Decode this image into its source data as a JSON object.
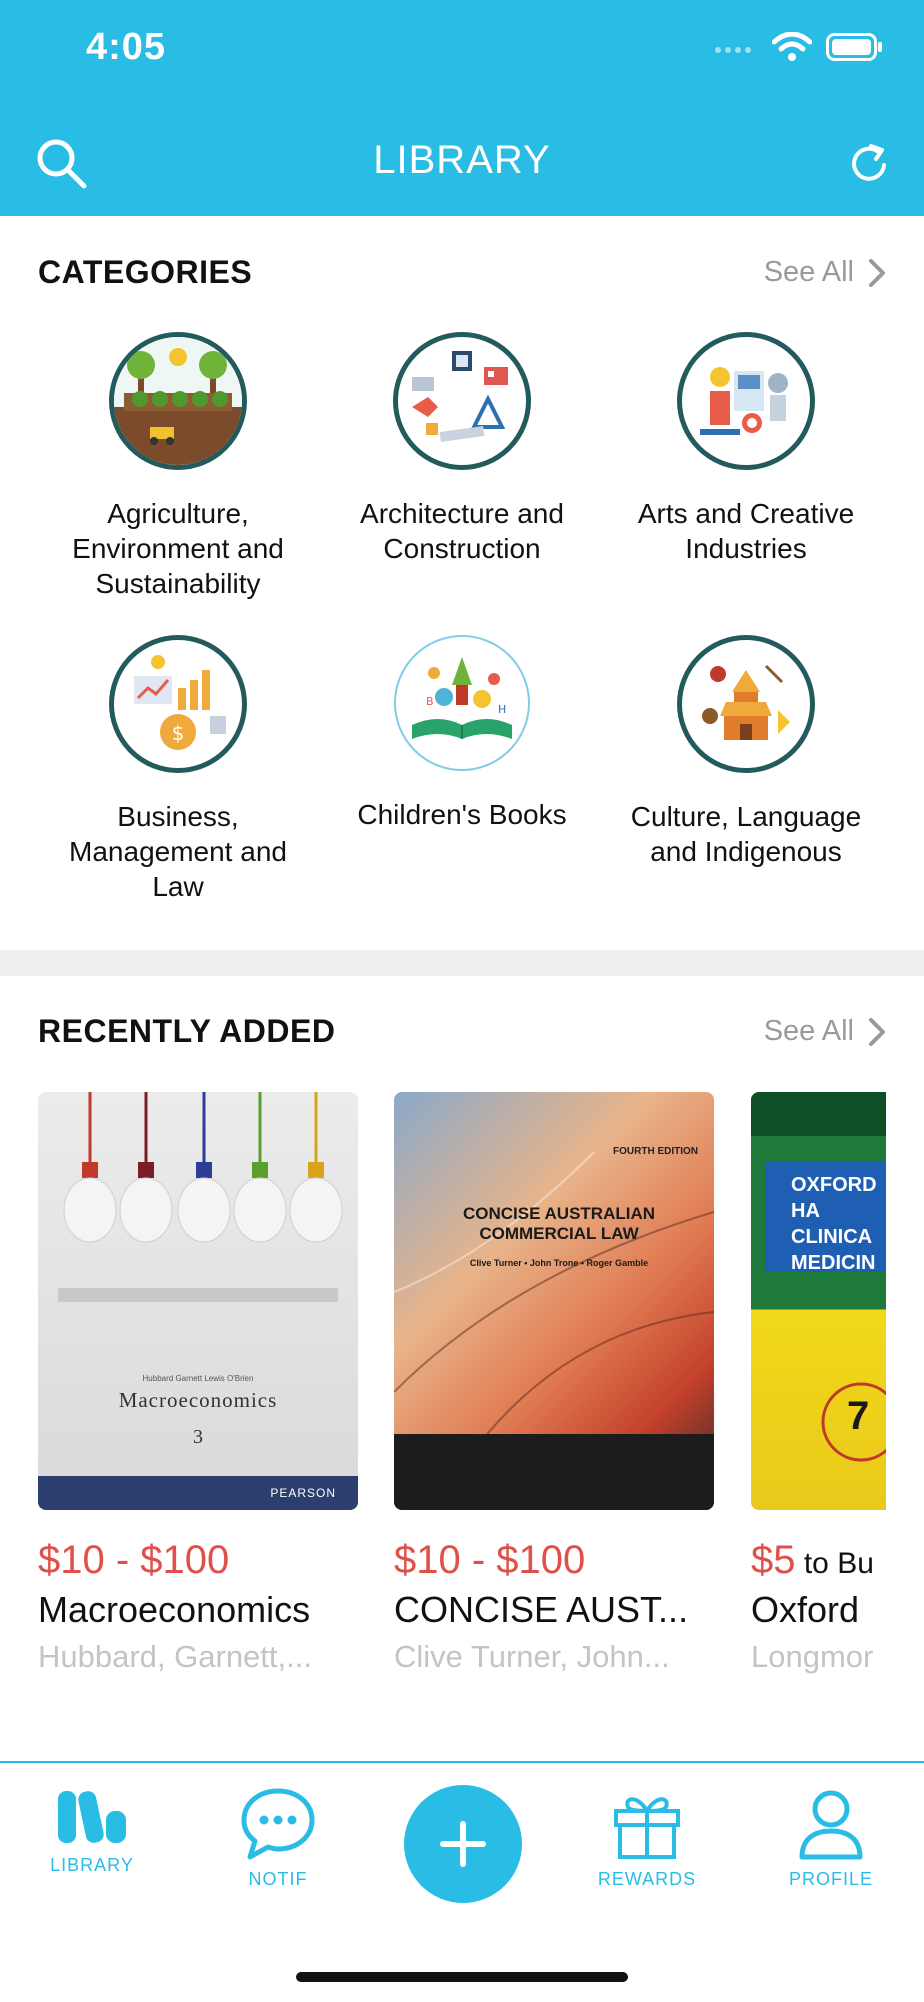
{
  "status": {
    "time": "4:05"
  },
  "header": {
    "title": "LIBRARY"
  },
  "categories": {
    "heading": "CATEGORIES",
    "see_all": "See All",
    "items": [
      {
        "label": "Agriculture, Environment and Sustainability",
        "icon": "agriculture-icon"
      },
      {
        "label": "Architecture and Construction",
        "icon": "architecture-icon"
      },
      {
        "label": "Arts and Creative Industries",
        "icon": "arts-icon"
      },
      {
        "label": "Business, Management and Law",
        "icon": "business-icon"
      },
      {
        "label": "Children's Books",
        "icon": "childrens-books-icon"
      },
      {
        "label": "Culture, Language and Indigenous",
        "icon": "culture-icon"
      }
    ]
  },
  "recent": {
    "heading": "RECENTLY ADDED",
    "see_all": "See All",
    "books": [
      {
        "price": "$10 - $100",
        "price_suffix": "",
        "title": "Macroeconomics",
        "author": "Hubbard, Garnett,...",
        "cover_title": "Macroeconomics",
        "cover_edition": "3",
        "cover_authors": "Hubbard Garnett Lewis O'Brien",
        "cover_publisher": "PEARSON"
      },
      {
        "price": "$10 - $100",
        "price_suffix": "",
        "title": "CONCISE AUST...",
        "author": "Clive Turner, John...",
        "cover_title": "CONCISE AUSTRALIAN COMMERCIAL LAW",
        "cover_edition": "FOURTH EDITION",
        "cover_authors": "Clive Turner • John Trone • Roger Gamble"
      },
      {
        "price": "$5",
        "price_suffix": " to Bu",
        "title": "Oxford",
        "author": "Longmor",
        "cover_title": "OXFORD HA CLINICA MEDICIN",
        "cover_edition": "7"
      }
    ]
  },
  "tabs": {
    "library": "LIBRARY",
    "notif": "NOTIF",
    "rewards": "REWARDS",
    "profile": "PROFILE"
  },
  "colors": {
    "brand": "#29BDE6",
    "price": "#E0504A",
    "circle_border": "#235a5c"
  }
}
